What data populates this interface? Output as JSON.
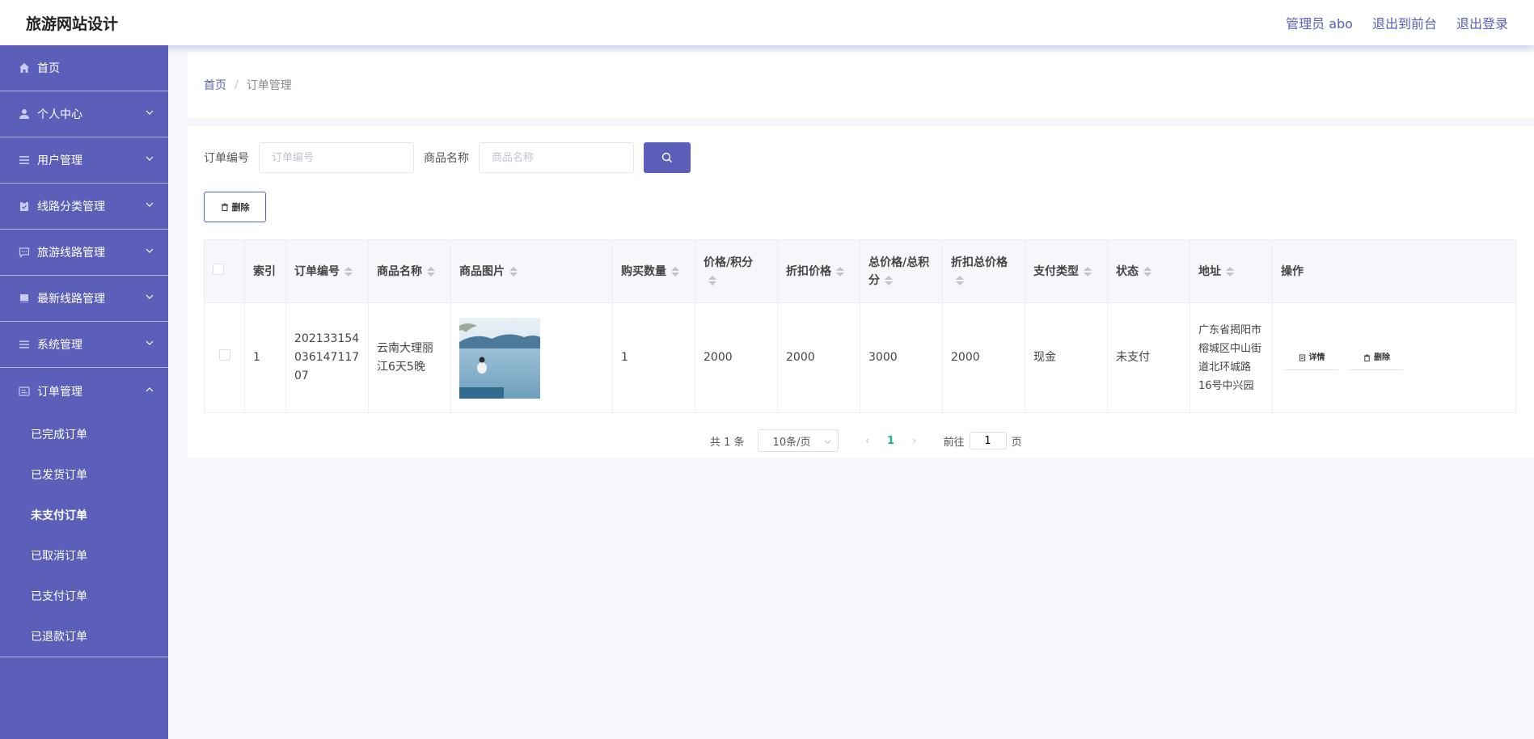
{
  "header": {
    "title": "旅游网站设计",
    "admin": "管理员 abo",
    "to_front": "退出到前台",
    "logout": "退出登录"
  },
  "sidebar": {
    "items": [
      {
        "label": "首页",
        "icon": "home-icon"
      },
      {
        "label": "个人中心",
        "icon": "user-icon"
      },
      {
        "label": "用户管理",
        "icon": "list-icon"
      },
      {
        "label": "线路分类管理",
        "icon": "clipboard-icon"
      },
      {
        "label": "旅游线路管理",
        "icon": "chat-icon"
      },
      {
        "label": "最新线路管理",
        "icon": "book-icon"
      },
      {
        "label": "系统管理",
        "icon": "menu-icon"
      },
      {
        "label": "订单管理",
        "icon": "order-icon"
      }
    ],
    "order_sub": [
      "已完成订单",
      "已发货订单",
      "未支付订单",
      "已取消订单",
      "已支付订单",
      "已退款订单"
    ]
  },
  "breadcrumb": {
    "home": "首页",
    "sep": "/",
    "current": "订单管理"
  },
  "search": {
    "order_label": "订单编号",
    "order_placeholder": "订单编号",
    "goods_label": "商品名称",
    "goods_placeholder": "商品名称"
  },
  "delete_label": "删除",
  "table": {
    "headers": {
      "index": "索引",
      "order_no": "订单编号",
      "goods": "商品名称",
      "image": "商品图片",
      "qty": "购买数量",
      "price": "价格/积分",
      "discount": "折扣价格",
      "total": "总价格/总积分",
      "discount_total": "折扣总价格",
      "pay_type": "支付类型",
      "status": "状态",
      "address": "地址",
      "ops": "操作"
    },
    "rows": [
      {
        "index": "1",
        "order_no": "20213315403614711707",
        "goods": "云南大理丽江6天5晚",
        "qty": "1",
        "price": "2000",
        "discount": "2000",
        "total": "3000",
        "discount_total": "2000",
        "pay_type": "现金",
        "status": "未支付",
        "address": "广东省揭阳市榕城区中山街道北环城路16号中兴园",
        "detail_label": "详情",
        "delete_label": "删除"
      }
    ]
  },
  "pagination": {
    "total": "共 1 条",
    "page_size": "10条/页",
    "current": "1",
    "goto_prefix": "前往",
    "goto_value": "1",
    "goto_suffix": "页"
  },
  "colors": {
    "accent": "#5c5fb9",
    "active_page": "#19b394"
  }
}
